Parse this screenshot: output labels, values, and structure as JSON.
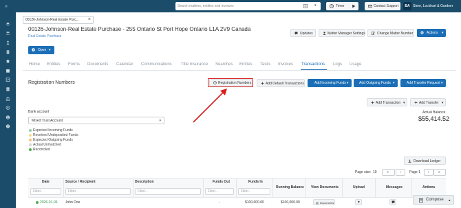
{
  "sidebar": {
    "expand_label": "»",
    "items": [
      {
        "icon": "layers-icon"
      },
      {
        "icon": "users-icon"
      },
      {
        "icon": "person-icon"
      },
      {
        "icon": "document-icon"
      },
      {
        "icon": "home-icon"
      },
      {
        "icon": "calendar-icon"
      },
      {
        "icon": "checklist-icon"
      },
      {
        "icon": "invoice-icon"
      },
      {
        "icon": "bank-icon"
      },
      {
        "icon": "contacts-icon"
      },
      {
        "icon": "account-icon"
      },
      {
        "icon": "settings-icon"
      },
      {
        "icon": "help-icon"
      }
    ]
  },
  "topbar": {
    "search_placeholder": "Search matters, entities and invoices",
    "timer_label": "Timer",
    "support_label": "Contact Support",
    "avatar_initials": "BA",
    "firm_name": "Stern, Lockhart & Gardner"
  },
  "matter_tab": {
    "label": "00126-Johnson-Real Estate Purc...",
    "close": "×"
  },
  "matter": {
    "title": "00126-Johnson-Real Estate Purchase - 255 Ontario St Port Hope Ontario L1A 2V9 Canada",
    "type": "Real Estate Purchase",
    "status": "Open"
  },
  "header_actions": {
    "updates": "Updates",
    "matter_manager": "Matter Manager Settings",
    "change_number": "Change Matter Number",
    "actions": "Actions"
  },
  "tabs": [
    {
      "label": "Home"
    },
    {
      "label": "Entities"
    },
    {
      "label": "Forms"
    },
    {
      "label": "Documents"
    },
    {
      "label": "Calendar"
    },
    {
      "label": "Communications"
    },
    {
      "label": "Title Insurance"
    },
    {
      "label": "Searches"
    },
    {
      "label": "Entries"
    },
    {
      "label": "Tasks"
    },
    {
      "label": "Invoices"
    },
    {
      "label": "Transactions",
      "active": true
    },
    {
      "label": "Logs"
    },
    {
      "label": "Usage"
    }
  ],
  "section": {
    "title": "Registration Numbers",
    "registration_numbers_btn": "Registration Numbers",
    "add_default_btn": "Add Default Transactions",
    "add_incoming_btn": "Add Incoming Funds",
    "add_outgoing_btn": "Add Outgoing Funds",
    "add_transfer_request_btn": "Add Transfer Request"
  },
  "secondary_actions": {
    "add_transaction": "Add Transaction",
    "add_transfer": "Add Transfer"
  },
  "bank": {
    "label": "Bank account",
    "selected": "Mixed Trust Account"
  },
  "legend": [
    {
      "label": "Expected Incoming Funds",
      "color": "#8fd0a4"
    },
    {
      "label": "Received Undeposited Funds",
      "color": "#f3e08a"
    },
    {
      "label": "Expected Outgoing Funds",
      "color": "#f4c27a"
    },
    {
      "label": "Actual Unmatched",
      "color": "#e9ecef"
    },
    {
      "label": "Reconciled",
      "color": "#4caf50"
    }
  ],
  "balance": {
    "label": "Actual Balance",
    "value": "$55,414.52"
  },
  "ledger": {
    "download_label": "Download Ledger"
  },
  "pager": {
    "page_size_label": "Page size:",
    "page_size": "10",
    "first": "«",
    "prev": "‹",
    "page_label": "Page 1",
    "next": "›",
    "last": "»"
  },
  "table": {
    "columns": [
      "Date",
      "Source / Recipient",
      "Description",
      "Funds Out",
      "Funds In",
      "Running Balance",
      "View Documents",
      "Upload",
      "Messages",
      "Actions"
    ],
    "filter_placeholder": "Filter...",
    "rows": [
      {
        "date": "2026-01-06",
        "source": "John Doe",
        "description": "",
        "funds_out": "-",
        "funds_in": "$100,000.00",
        "running_balance": "$100,000.00",
        "view_docs": "Documents"
      }
    ]
  },
  "compose": {
    "label": "Compose"
  },
  "colors": {
    "sidebar": "#1b4d6b",
    "primary": "#1c6fb6",
    "highlight": "#d9201c",
    "link": "#4a86c5"
  }
}
